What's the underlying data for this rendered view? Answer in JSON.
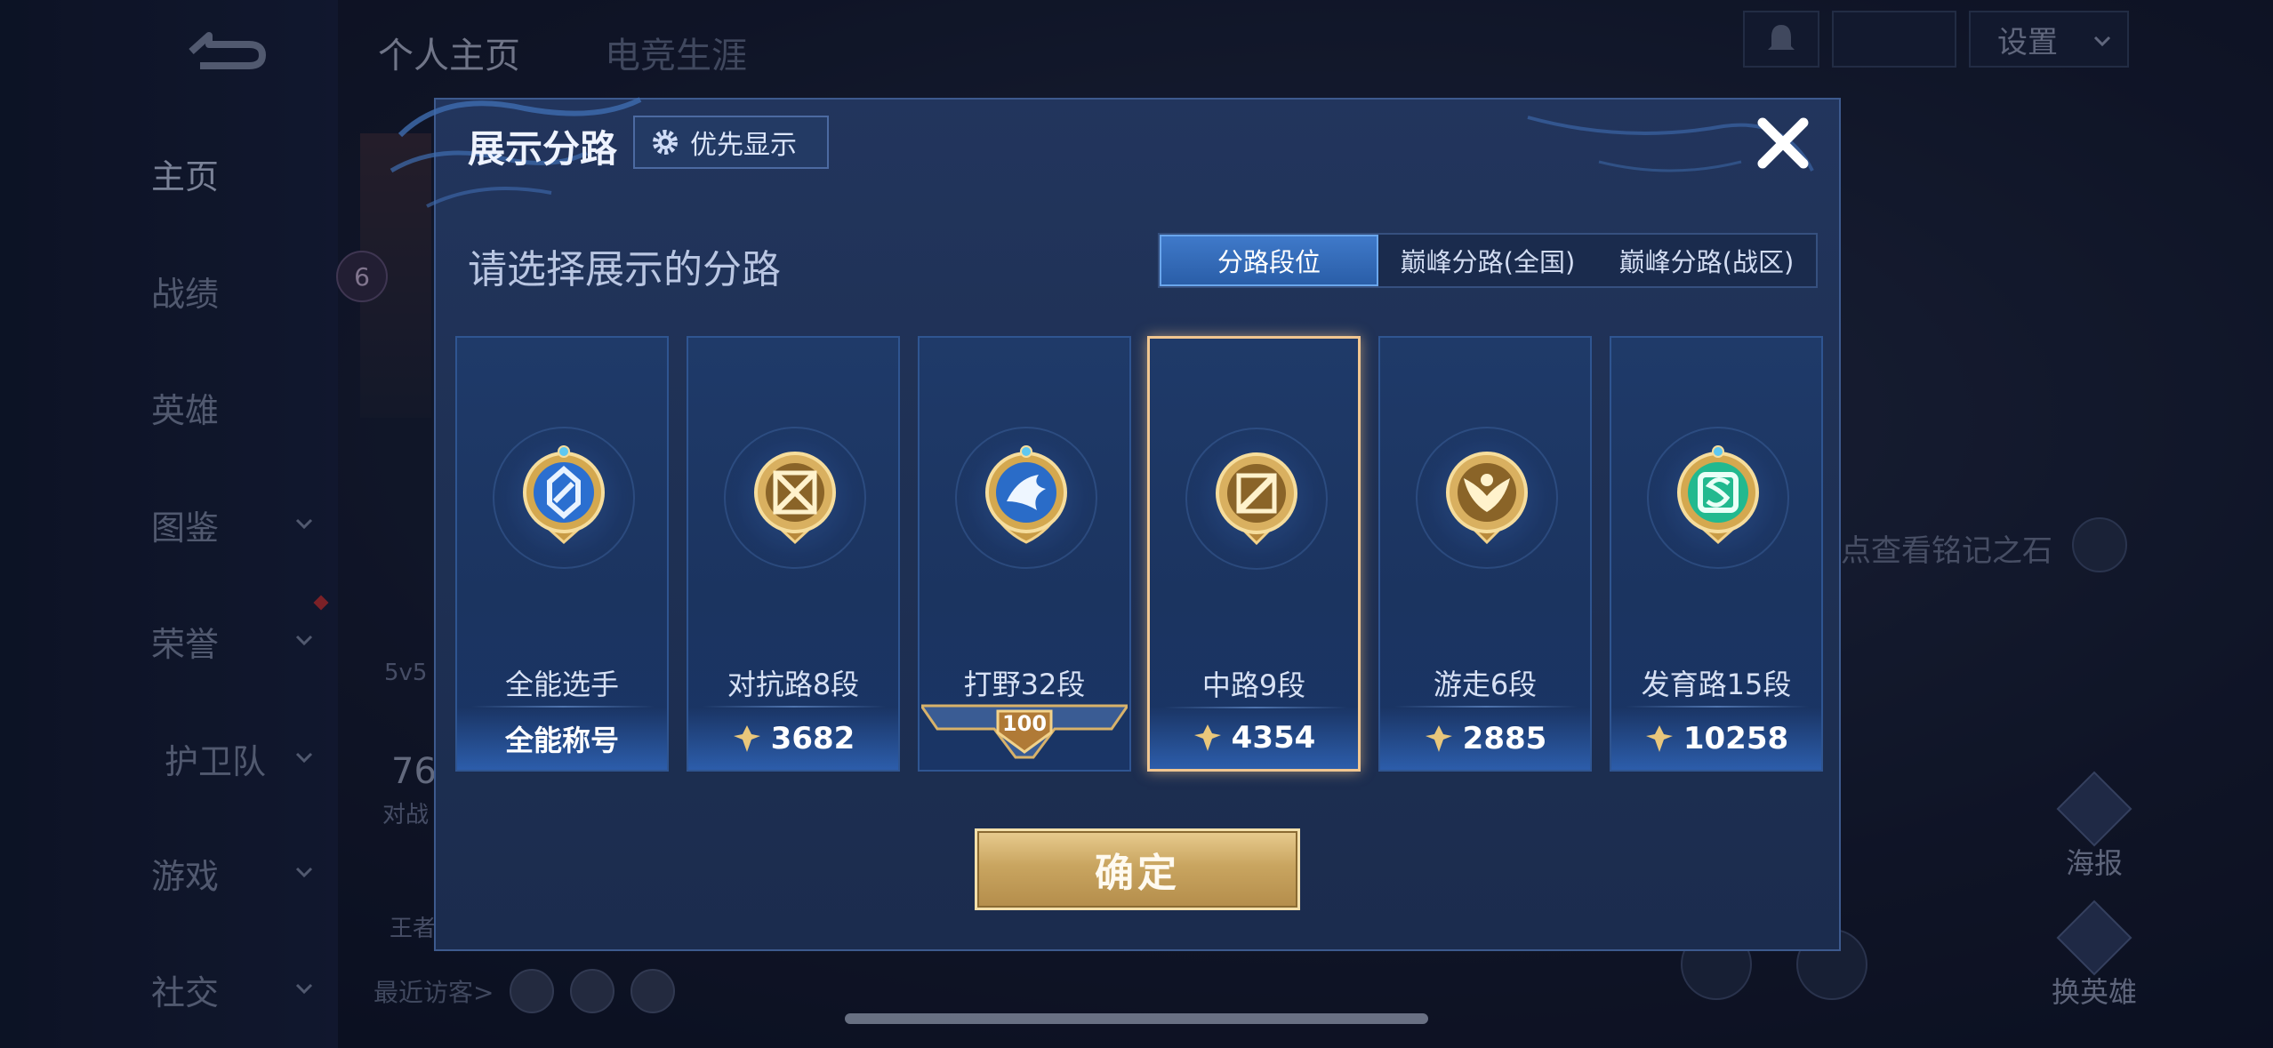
{
  "background": {
    "back_label": "",
    "top_tabs": [
      "个人主页",
      "电竞生涯"
    ],
    "settings_label": "设置",
    "sidebar_items": [
      {
        "label": "主页",
        "has_chevron": false
      },
      {
        "label": "战绩",
        "has_chevron": false
      },
      {
        "label": "英雄",
        "has_chevron": false
      },
      {
        "label": "图鉴",
        "has_chevron": true
      },
      {
        "label": "荣誉",
        "has_chevron": true
      },
      {
        "label": "护卫队",
        "has_chevron": true
      },
      {
        "label": "游戏",
        "has_chevron": true
      },
      {
        "label": "社交",
        "has_chevron": true
      }
    ],
    "level": "6",
    "left_frag_mode": "5v5",
    "left_frag_num": "76",
    "left_frag_battle": "对战",
    "left_frag_king": "王者",
    "right_hint": "点查看铭记之石",
    "poster_label": "海报",
    "switch_hero_label": "换英雄",
    "recent_visitors_label": "最近访客>"
  },
  "modal": {
    "title": "展示分路",
    "priority_button": "优先显示",
    "subtitle": "请选择展示的分路",
    "tabs": [
      {
        "label": "分路段位",
        "active": true
      },
      {
        "label": "巅峰分路(全国)",
        "active": false
      },
      {
        "label": "巅峰分路(战区)",
        "active": false
      }
    ],
    "cards": [
      {
        "name": "全能选手",
        "value": "全能称号",
        "value_type": "title",
        "badge_color": "#4a8fe0",
        "selected": false
      },
      {
        "name": "对抗路8段",
        "value": "3682",
        "value_type": "points",
        "badge_color": "#c89b45",
        "selected": false
      },
      {
        "name": "打野32段",
        "value": "100",
        "value_type": "rank",
        "badge_color": "#3f86d8",
        "selected": false
      },
      {
        "name": "中路9段",
        "value": "4354",
        "value_type": "points",
        "badge_color": "#c89b45",
        "selected": true
      },
      {
        "name": "游走6段",
        "value": "2885",
        "value_type": "points",
        "badge_color": "#c89b45",
        "selected": false
      },
      {
        "name": "发育路15段",
        "value": "10258",
        "value_type": "points",
        "badge_color": "#2fc9a2",
        "selected": false
      }
    ],
    "confirm_button": "确定"
  },
  "colors": {
    "gold": "#c9a560",
    "accent_blue": "#3f79c9",
    "selected_border": "#f1c690"
  }
}
